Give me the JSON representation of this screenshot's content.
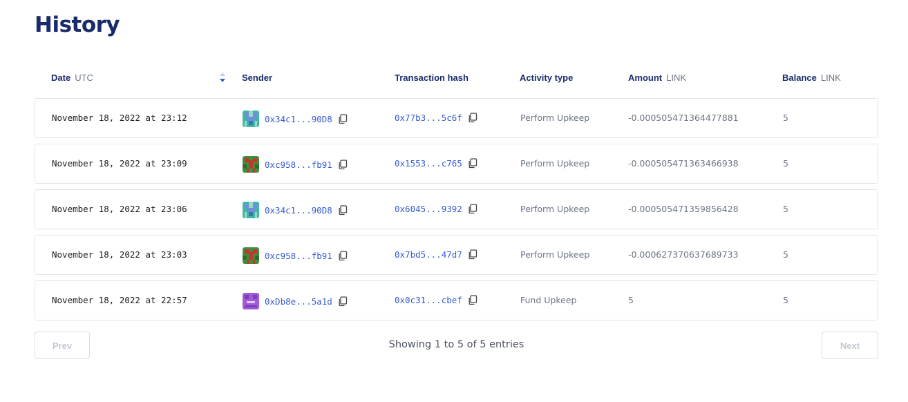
{
  "page": {
    "title": "History"
  },
  "table": {
    "columns": {
      "date": {
        "label": "Date",
        "unit": "UTC"
      },
      "sender": {
        "label": "Sender"
      },
      "hash": {
        "label": "Transaction hash"
      },
      "activity": {
        "label": "Activity type"
      },
      "amount": {
        "label": "Amount",
        "unit": "LINK"
      },
      "balance": {
        "label": "Balance",
        "unit": "LINK"
      }
    },
    "sort_icon": "sort-icon",
    "rows": [
      {
        "date": "November 18, 2022 at 23:12",
        "sender": "0x34c1...90D8",
        "avatar": "teal",
        "hash": "0x77b3...5c6f",
        "activity": "Perform Upkeep",
        "amount": "-0.000505471364477881",
        "balance": "5"
      },
      {
        "date": "November 18, 2022 at 23:09",
        "sender": "0xc958...fb91",
        "avatar": "green",
        "hash": "0x1553...c765",
        "activity": "Perform Upkeep",
        "amount": "-0.000505471363466938",
        "balance": "5"
      },
      {
        "date": "November 18, 2022 at 23:06",
        "sender": "0x34c1...90D8",
        "avatar": "teal",
        "hash": "0x6045...9392",
        "activity": "Perform Upkeep",
        "amount": "-0.000505471359856428",
        "balance": "5"
      },
      {
        "date": "November 18, 2022 at 23:03",
        "sender": "0xc958...fb91",
        "avatar": "green",
        "hash": "0x7bd5...47d7",
        "activity": "Perform Upkeep",
        "amount": "-0.000627370637689733",
        "balance": "5"
      },
      {
        "date": "November 18, 2022 at 22:57",
        "sender": "0xDb8e...5a1d",
        "avatar": "purple",
        "hash": "0x0c31...cbef",
        "activity": "Fund Upkeep",
        "amount": "5",
        "balance": "5"
      }
    ]
  },
  "pagination": {
    "prev_label": "Prev",
    "next_label": "Next",
    "summary": "Showing 1 to 5 of 5 entries"
  },
  "colors": {
    "title": "#1a2b6b",
    "link": "#375bd2",
    "muted": "#6c7585",
    "border": "#e1e4ea"
  },
  "icons": {
    "copy": "copy-icon",
    "avatar": "identicon-avatar"
  }
}
